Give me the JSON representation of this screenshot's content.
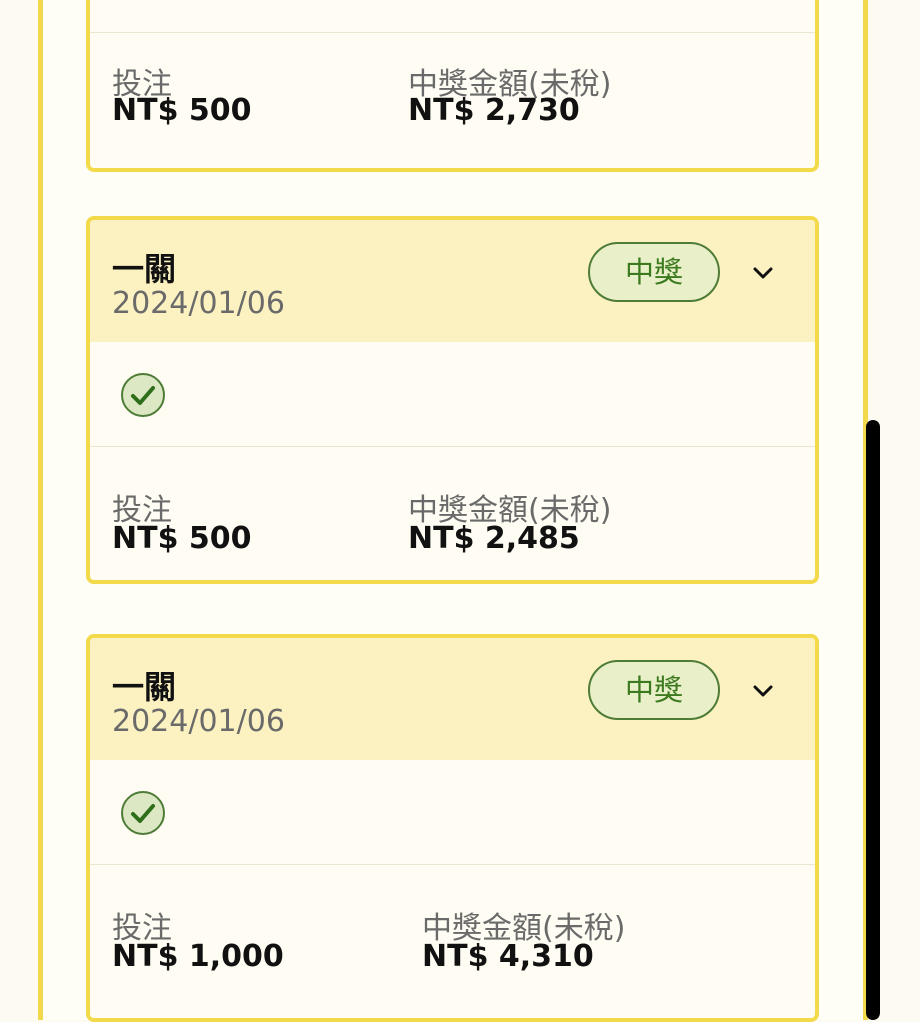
{
  "cards": [
    {
      "bet_label": "投注",
      "bet_value": "NT$ 500",
      "prize_label": "中獎金額(未稅)",
      "prize_value": "NT$ 2,730"
    },
    {
      "title": "一關",
      "date": "2024/01/06",
      "badge": "中獎",
      "bet_label": "投注",
      "bet_value": "NT$ 500",
      "prize_label": "中獎金額(未稅)",
      "prize_value": "NT$ 2,485"
    },
    {
      "title": "一關",
      "date": "2024/01/06",
      "badge": "中獎",
      "bet_label": "投注",
      "bet_value": "NT$ 1,000",
      "prize_label": "中獎金額(未稅)",
      "prize_value": "NT$ 4,310"
    }
  ],
  "icons": {
    "chevron": "chevron-down-icon",
    "check": "check-circle-icon"
  },
  "colors": {
    "accent_border": "#f3da4a",
    "header_bg": "#fbf1c1",
    "win_green": "#3c7a1f"
  }
}
